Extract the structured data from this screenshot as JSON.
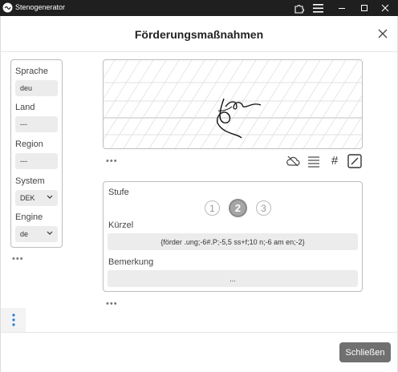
{
  "window": {
    "app_title": "Stenogenerator",
    "controls": [
      "puzzle-icon",
      "hamburger-icon",
      "minimize-icon",
      "maximize-icon",
      "close-icon"
    ]
  },
  "dialog": {
    "title": "Förderungsmaßnahmen",
    "close_icon": "close-icon"
  },
  "sidebar": {
    "sprache": {
      "label": "Sprache",
      "value": "deu"
    },
    "land": {
      "label": "Land",
      "value": "---"
    },
    "region": {
      "label": "Region",
      "value": "---"
    },
    "system": {
      "label": "System",
      "value": "DEK"
    },
    "engine": {
      "label": "Engine",
      "value": "de"
    },
    "more": "•••"
  },
  "canvas": {
    "more": "•••",
    "tools": [
      "cloud-icon",
      "lines-icon",
      "hash-icon",
      "edit-icon"
    ],
    "hash_glyph": "#"
  },
  "properties": {
    "stufe_label": "Stufe",
    "steps": [
      "1",
      "2",
      "3"
    ],
    "active_step": "2",
    "kuerzel_label": "Kürzel",
    "kuerzel_value": "{förder .ung;-6#.P;-5,5 ss+f;10 n;-6 am en;-2}",
    "bemerkung_label": "Bemerkung",
    "bemerkung_value": "...",
    "more": "•••"
  },
  "side_menu_icon": "vertical-dots-icon",
  "footer": {
    "close_label": "Schließen"
  },
  "colors": {
    "titlebar": "#1f1f1f",
    "field_bg": "#ececec",
    "border": "#bdbdbd",
    "button": "#707070"
  }
}
